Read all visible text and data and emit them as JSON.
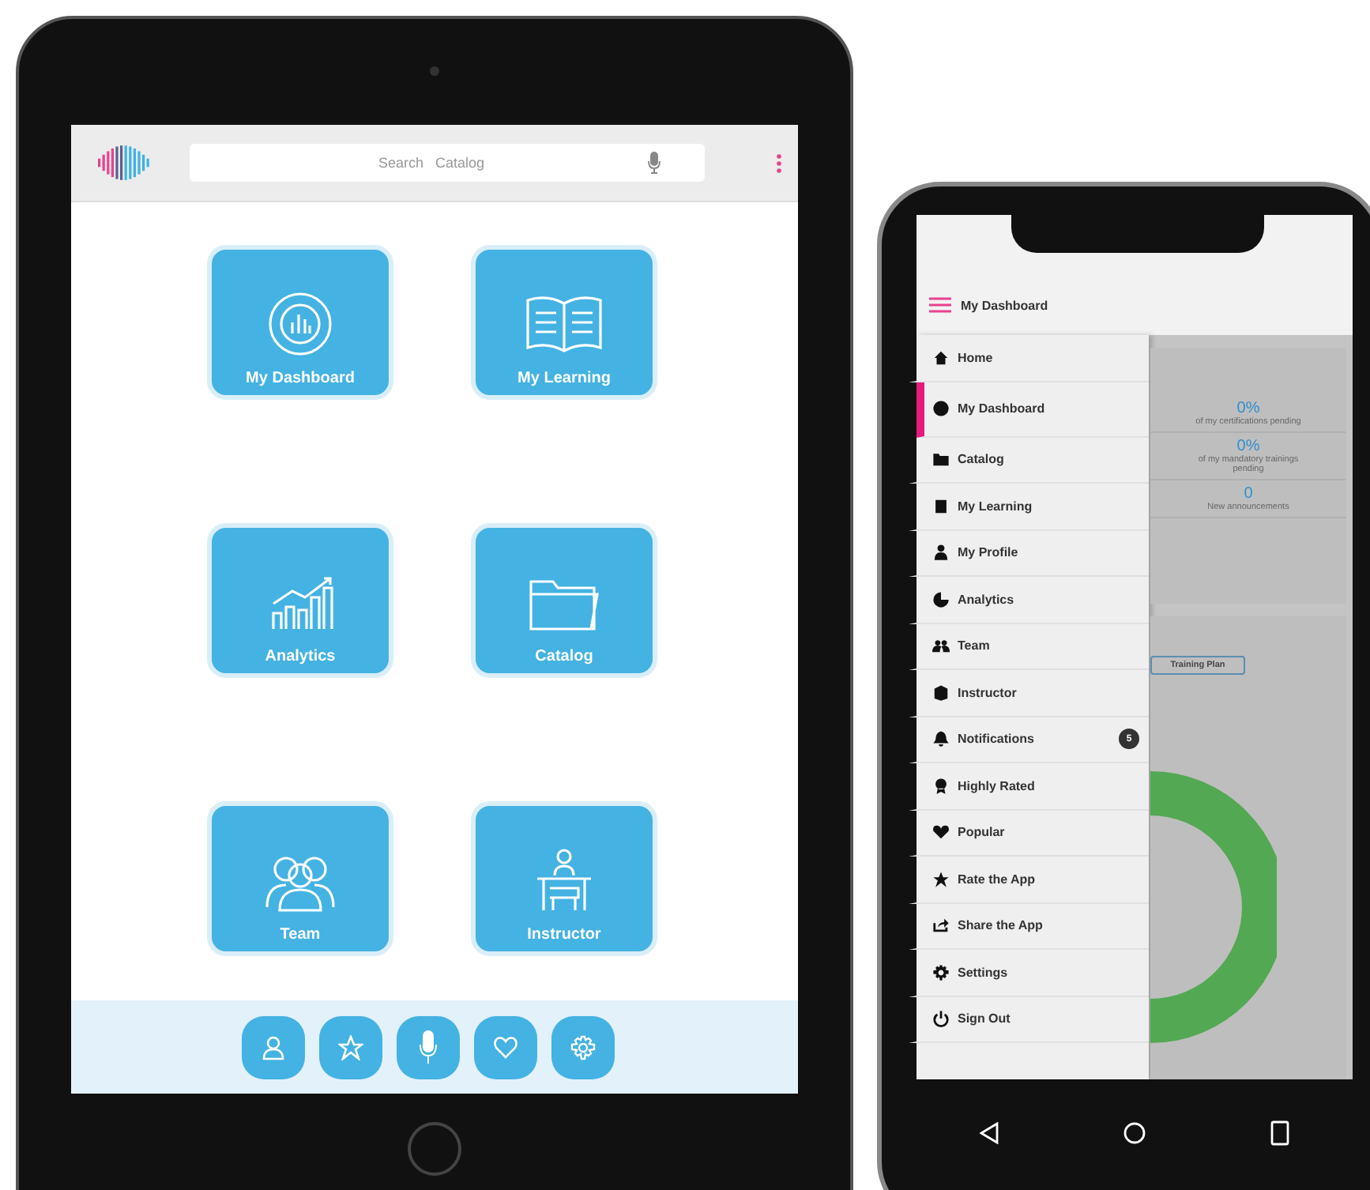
{
  "tablet": {
    "search": {
      "placeholder": "Search   Catalog"
    },
    "tiles": [
      {
        "label": "My Dashboard"
      },
      {
        "label": "My Learning"
      },
      {
        "label": "Analytics"
      },
      {
        "label": "Catalog"
      },
      {
        "label": "Team"
      },
      {
        "label": "Instructor"
      }
    ]
  },
  "phone": {
    "header": {
      "title": "My Dashboard"
    },
    "menu": [
      {
        "label": "Home",
        "selected": false
      },
      {
        "label": "My Dashboard",
        "selected": true
      },
      {
        "label": "Catalog",
        "selected": false
      },
      {
        "label": "My Learning",
        "selected": false
      },
      {
        "label": "My Profile",
        "selected": false
      },
      {
        "label": "Analytics",
        "selected": false
      },
      {
        "label": "Team",
        "selected": false
      },
      {
        "label": "Instructor",
        "selected": false
      },
      {
        "label": "Notifications",
        "selected": false,
        "badge": "5"
      },
      {
        "label": "Highly Rated",
        "selected": false
      },
      {
        "label": "Popular",
        "selected": false
      },
      {
        "label": "Rate the App",
        "selected": false
      },
      {
        "label": "Share the App",
        "selected": false
      },
      {
        "label": "Settings",
        "selected": false
      },
      {
        "label": "Sign Out",
        "selected": false
      }
    ],
    "stats": [
      {
        "value": "0%",
        "caption": "of my certifications pending"
      },
      {
        "value": "0%",
        "caption": "of my mandatory trainings pending"
      },
      {
        "value": "0",
        "caption": "New announcements"
      }
    ],
    "training_plan_button": "Training Plan"
  }
}
